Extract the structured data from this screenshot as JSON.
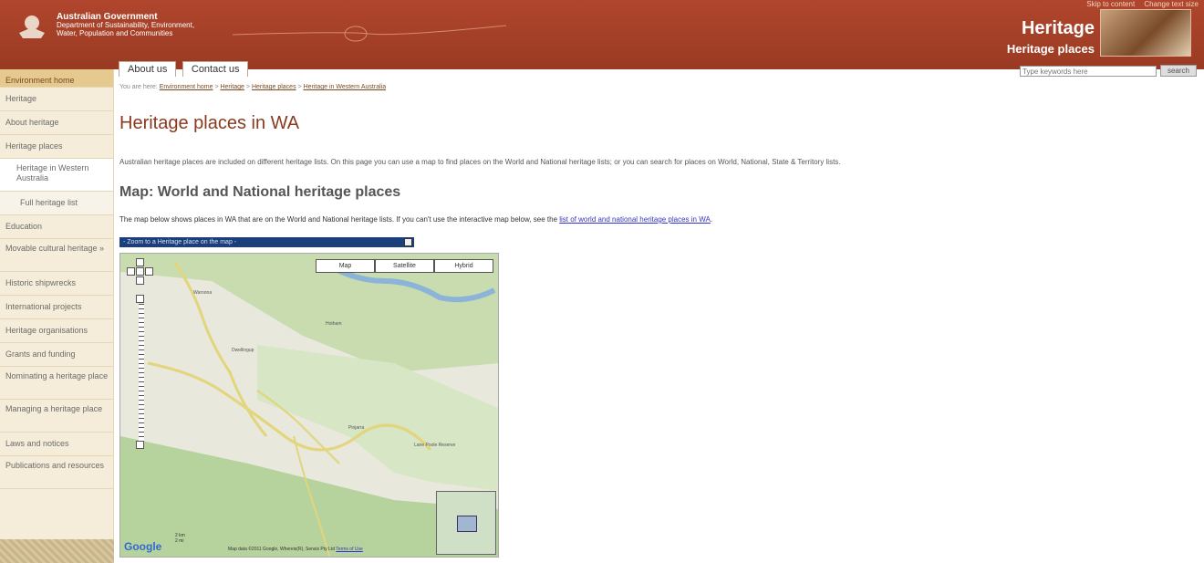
{
  "banner": {
    "toplinks": [
      "Skip to content",
      "Change text size"
    ],
    "gov_line1": "Australian Government",
    "gov_line2": "Department of Sustainability, Environment,",
    "gov_line3": "Water, Population and Communities",
    "title": "Heritage",
    "subtitle": "Heritage places"
  },
  "search": {
    "placeholder": "Type keywords here",
    "button": "search"
  },
  "tabs": [
    "About us",
    "Contact us"
  ],
  "sidebar": {
    "items": [
      {
        "label": "Environment home",
        "type": "top"
      },
      {
        "label": "Heritage",
        "type": "normal"
      },
      {
        "label": "About heritage",
        "type": "normal"
      },
      {
        "label": "Heritage places",
        "type": "normal"
      },
      {
        "label": "Heritage in Western Australia",
        "type": "sub"
      },
      {
        "label": "Full heritage list",
        "type": "sub2"
      },
      {
        "label": "Education",
        "type": "normal"
      },
      {
        "label": "Movable cultural heritage »",
        "type": "normal"
      },
      {
        "label": "Historic shipwrecks",
        "type": "normal"
      },
      {
        "label": "International projects",
        "type": "normal"
      },
      {
        "label": "Heritage organisations",
        "type": "normal"
      },
      {
        "label": "Grants and funding",
        "type": "normal"
      },
      {
        "label": "Nominating a heritage place",
        "type": "normal"
      },
      {
        "label": "Managing a heritage place",
        "type": "normal"
      },
      {
        "label": "Laws and notices",
        "type": "normal"
      },
      {
        "label": "Publications and resources",
        "type": "normal"
      }
    ]
  },
  "breadcrumb": {
    "prefix": "You are here:",
    "items": [
      "Environment home",
      "Heritage",
      "Heritage places",
      "Heritage in Western Australia"
    ]
  },
  "page": {
    "title": "Heritage places in WA",
    "intro": "Australian heritage places are included on different heritage lists. On this page you can use a map to find places on the World and National heritage lists; or you can search for places on World, National, State & Territory lists.",
    "map_heading": "Map: World and National heritage places",
    "map_intro": "The map below shows places in WA that are on the World and National heritage lists. If you can't use the interactive map below, see the",
    "map_intro_link": "list of world and national heritage places in WA",
    "zoom_select": "- Zoom to a Heritage place on the map -"
  },
  "map": {
    "types": [
      "Map",
      "Satellite",
      "Hybrid"
    ],
    "credit": "Map data ©2011 Google, Whereis(R), Sensis Pty Ltd",
    "terms": "Terms of Use",
    "scale": [
      "2 km",
      "2 mi"
    ],
    "place_labels": [
      "Dwellingup",
      "Waroona",
      "Pinjarra",
      "Hotham",
      "Lane Poole Reserve"
    ]
  }
}
